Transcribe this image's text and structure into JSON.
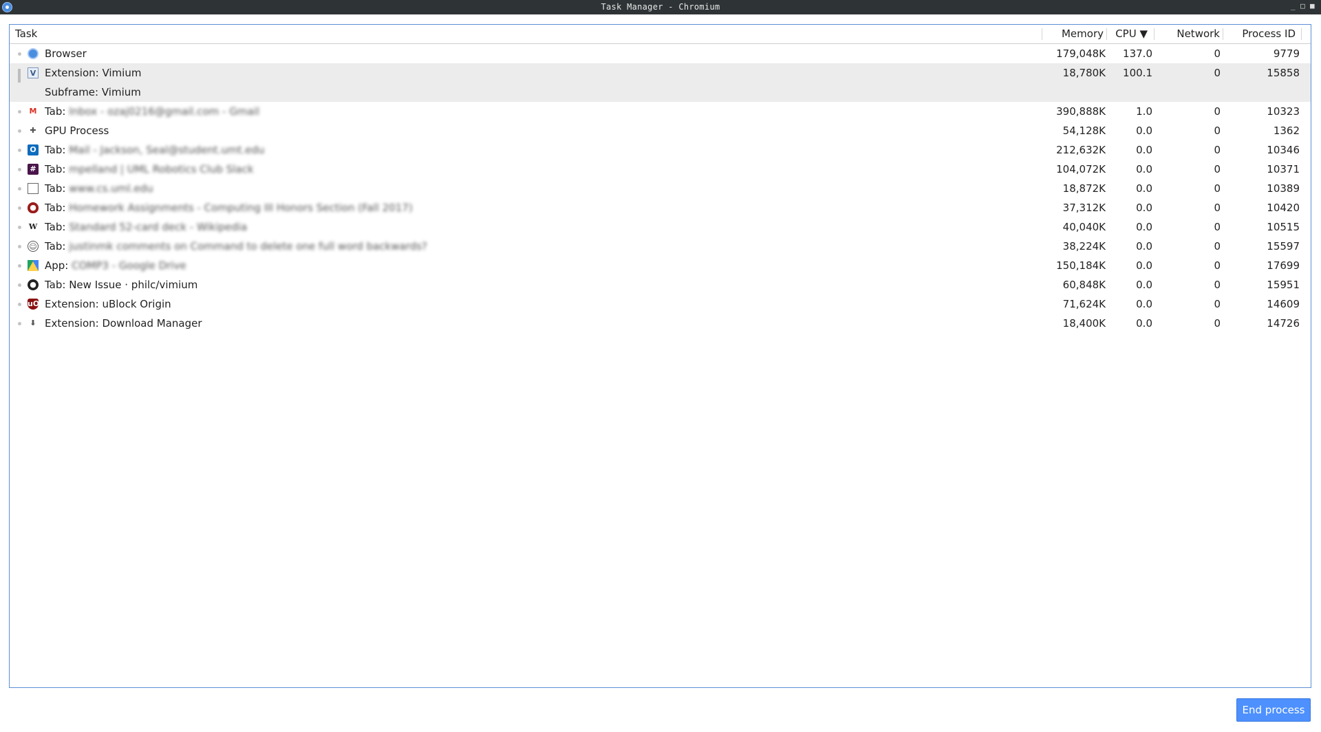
{
  "window": {
    "title": "Task Manager - Chromium",
    "controls": {
      "minimize": "_",
      "maximize": "□",
      "close": "■"
    }
  },
  "columns": {
    "task": "Task",
    "memory": "Memory",
    "cpu": "CPU ▼",
    "network": "Network",
    "pid": "Process ID"
  },
  "rows": [
    {
      "icon": "chromium-icon",
      "label": "Browser",
      "detail": "",
      "memory": "179,048K",
      "cpu": "137.0",
      "network": "0",
      "pid": "9779"
    },
    {
      "icon": "vimium-icon",
      "label": "Extension: Vimium",
      "detail": "",
      "memory": "18,780K",
      "cpu": "100.1",
      "network": "0",
      "pid": "15858"
    },
    {
      "icon": "",
      "label": "Subframe: Vimium",
      "detail": "",
      "memory": "",
      "cpu": "",
      "network": "",
      "pid": ""
    },
    {
      "icon": "gmail-icon",
      "label": "Tab:",
      "detail": "Inbox - ozaj0216@gmail.com - Gmail",
      "memory": "390,888K",
      "cpu": "1.0",
      "network": "0",
      "pid": "10323"
    },
    {
      "icon": "puzzle-icon",
      "label": "GPU Process",
      "detail": "",
      "memory": "54,128K",
      "cpu": "0.0",
      "network": "0",
      "pid": "1362"
    },
    {
      "icon": "outlook-icon",
      "label": "Tab:",
      "detail": "Mail - Jackson, Seal@student.umt.edu",
      "memory": "212,632K",
      "cpu": "0.0",
      "network": "0",
      "pid": "10346"
    },
    {
      "icon": "slack-icon",
      "label": "Tab:",
      "detail": "mpelland | UML Robotics Club Slack",
      "memory": "104,072K",
      "cpu": "0.0",
      "network": "0",
      "pid": "10371"
    },
    {
      "icon": "page-icon",
      "label": "Tab:",
      "detail": "www.cs.uml.edu",
      "memory": "18,872K",
      "cpu": "0.0",
      "network": "0",
      "pid": "10389"
    },
    {
      "icon": "shield-icon",
      "label": "Tab:",
      "detail": "Homework Assignments - Computing III Honors Section (Fall 2017)",
      "memory": "37,312K",
      "cpu": "0.0",
      "network": "0",
      "pid": "10420"
    },
    {
      "icon": "wikipedia-icon",
      "label": "Tab:",
      "detail": "Standard 52-card deck - Wikipedia",
      "memory": "40,040K",
      "cpu": "0.0",
      "network": "0",
      "pid": "10515"
    },
    {
      "icon": "reddit-icon",
      "label": "Tab:",
      "detail": "justinmk comments on Command to delete one full word backwards?",
      "memory": "38,224K",
      "cpu": "0.0",
      "network": "0",
      "pid": "15597"
    },
    {
      "icon": "google-drive-icon",
      "label": "App:",
      "detail": "COMP3 - Google Drive",
      "memory": "150,184K",
      "cpu": "0.0",
      "network": "0",
      "pid": "17699"
    },
    {
      "icon": "github-icon",
      "label": "Tab: New Issue · philc/vimium",
      "detail": "",
      "memory": "60,848K",
      "cpu": "0.0",
      "network": "0",
      "pid": "15951"
    },
    {
      "icon": "ublock-icon",
      "label": "Extension: uBlock Origin",
      "detail": "",
      "memory": "71,624K",
      "cpu": "0.0",
      "network": "0",
      "pid": "14609"
    },
    {
      "icon": "download-icon",
      "label": "Extension: Download Manager",
      "detail": "",
      "memory": "18,400K",
      "cpu": "0.0",
      "network": "0",
      "pid": "14726"
    }
  ],
  "selected_group": [
    "Extension: Vimium",
    "Subframe: Vimium"
  ],
  "end_process_label": "End process",
  "colors": {
    "accent": "#4d90fe",
    "titlebar": "#2e3436",
    "selection": "#ececec"
  }
}
